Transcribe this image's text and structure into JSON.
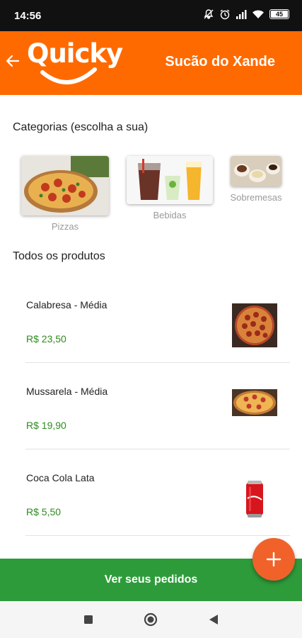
{
  "status_bar": {
    "time": "14:56",
    "battery": "45",
    "icons": [
      "mute-icon",
      "alarm-icon",
      "signal-icon",
      "wifi-icon",
      "battery-icon"
    ]
  },
  "app_bar": {
    "logo_text": "Quicky",
    "store_name": "Sucão do Xande",
    "background_color": "#ff6a00"
  },
  "categories_section": {
    "title": "Categorias (escolha a sua)",
    "items": [
      {
        "label": "Pizzas",
        "icon": "pizza-image"
      },
      {
        "label": "Bebidas",
        "icon": "drinks-image"
      },
      {
        "label": "Sobremesas",
        "icon": "desserts-image"
      }
    ]
  },
  "products_section": {
    "title": "Todos os produtos",
    "items": [
      {
        "name": "Calabresa - Média",
        "price": "R$ 23,50",
        "icon": "pepperoni-pizza-image"
      },
      {
        "name": "Mussarela - Média",
        "price": "R$ 19,90",
        "icon": "mozzarella-pizza-image"
      },
      {
        "name": "Coca Cola Lata",
        "price": "R$ 5,50",
        "icon": "coke-can-image"
      }
    ],
    "price_color": "#2e8b1f"
  },
  "bottom_bar": {
    "cta_label": "Ver seus pedidos",
    "cta_color": "#2e9b3b",
    "fab_icon": "plus-icon",
    "fab_color": "#f0622a"
  },
  "nav_bar": {
    "buttons": [
      "recents-square-icon",
      "home-circle-icon",
      "back-triangle-icon"
    ]
  }
}
